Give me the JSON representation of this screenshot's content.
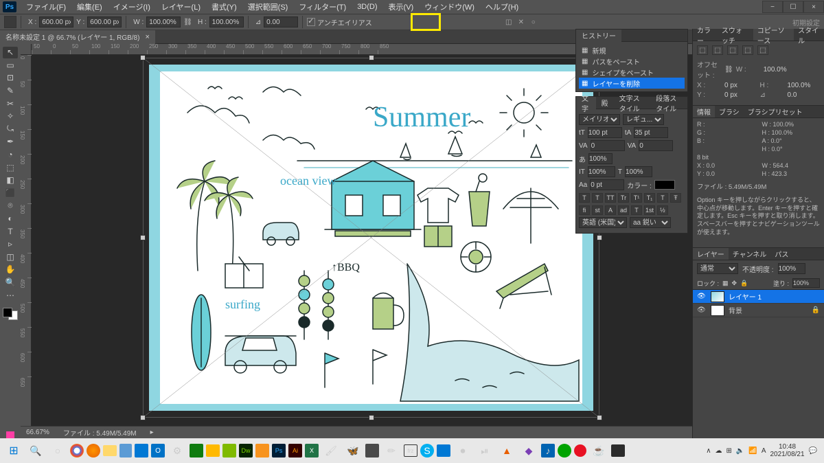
{
  "app": {
    "logo": "Ps"
  },
  "menu": {
    "items": [
      "ファイル(F)",
      "編集(E)",
      "イメージ(I)",
      "レイヤー(L)",
      "書式(Y)",
      "選択範囲(S)",
      "フィルター(T)",
      "3D(D)",
      "表示(V)",
      "ウィンドウ(W)",
      "ヘルプ(H)"
    ]
  },
  "winctrl": {
    "min": "−",
    "max": "☐",
    "close": "×"
  },
  "options": {
    "x_label": "X :",
    "x_val": "600.00 px",
    "y_label": "Y :",
    "y_val": "600.00 px",
    "w_label": "W :",
    "w_val": "100.00%",
    "h_label": "H :",
    "h_val": "100.00%",
    "angle_label": "⊿",
    "angle_val": "0.00",
    "antialias_label": "アンチエイリアス",
    "cancel_glyph": "✕",
    "commit_glyph": "○",
    "workspace": "初期設定"
  },
  "doctab": {
    "title": "名称未設定 1 @ 66.7% (レイヤー 1, RGB/8)",
    "close": "×"
  },
  "ruler_h": [
    "50",
    "0",
    "50",
    "100",
    "150",
    "200",
    "250",
    "300",
    "350",
    "400",
    "450",
    "500",
    "550",
    "600",
    "650",
    "700",
    "750",
    "800",
    "850"
  ],
  "ruler_v": [
    "0",
    "50",
    "100",
    "150",
    "200",
    "250",
    "300",
    "350",
    "400",
    "450",
    "500",
    "550",
    "600",
    "650"
  ],
  "tools": [
    "↖",
    "▭",
    "⊡",
    "✎",
    "✂",
    "✧",
    "⤿",
    "✒",
    "◔",
    "⬚",
    "◧",
    "⬛",
    "⌾",
    "◐",
    "T",
    "▹",
    "◫",
    "✋",
    "🔍",
    "⋯"
  ],
  "history": {
    "tab": "ヒストリー",
    "items": [
      "新規",
      "パスをペースト",
      "シェイプをペースト",
      "レイヤーを削除"
    ]
  },
  "char": {
    "tabs": [
      "文字",
      "殿",
      "文字スタイル",
      "段落スタイル"
    ],
    "font": "メイリオ",
    "style": "レギュ...",
    "size": "100 pt",
    "lead": "35 pt",
    "va": "VA",
    "va_val": "0",
    "tracking": "0",
    "scale_h": "100%",
    "scale_v": "100%",
    "baseline": "0 pt",
    "color_label": "カラー :",
    "styles": [
      "T",
      "T",
      "TT",
      "Tr",
      "T¹",
      "T₁",
      "T",
      "Ŧ"
    ],
    "lang": "英語 (米国)",
    "aa": "aa 鋭い"
  },
  "copysource": {
    "tabs": [
      "カラー",
      "スウォッチ",
      "コピーソース",
      "スタイル"
    ],
    "offset_label": "オフセット :",
    "x_label": "X :",
    "x_val": "0 px",
    "y_label": "Y :",
    "y_val": "0 px",
    "w_label": "W :",
    "w_val": "100.0%",
    "h_label": "H :",
    "h_val": "100.0%",
    "angle": "⊿",
    "angle_val": "0.0"
  },
  "info": {
    "tabs": [
      "情報",
      "ブラシ",
      "ブラシプリセット"
    ],
    "r": "R :",
    "g": "G :",
    "b": "B :",
    "w": "W :",
    "w_val": "100.0%",
    "h": "H :",
    "h_val": "100.0%",
    "a": "A :",
    "a_val": "0.0°",
    "hh": "H :",
    "hh_val": "0.0°",
    "bit": "8 bit",
    "x": "X :",
    "x_val": "0.0",
    "y": "Y :",
    "y_val": "0.0",
    "ww": "W :",
    "ww_val": "564.4",
    "hhh": "H :",
    "hhh_val": "423.3",
    "file": "ファイル : 5.49M/5.49M",
    "hint": "Option キーを押しながらクリックすると、中心点が移動します。Enter キーを押すと確定します。Esc キーを押すと取り消します。スペースバーを押すとナビゲーションツールが使えます。"
  },
  "layers": {
    "tabs": [
      "レイヤー",
      "チャンネル",
      "パス"
    ],
    "blend": "通常",
    "opacity_label": "不透明度 :",
    "opacity": "100%",
    "lock_label": "ロック :",
    "fill_label": "塗り :",
    "fill": "100%",
    "items": [
      "レイヤー 1",
      "背景"
    ]
  },
  "status": {
    "zoom": "66.67%",
    "file": "ファイル : 5.49M/5.49M"
  },
  "taskbar": {
    "start": "⊞",
    "icons": [
      "🔍",
      "○",
      "🌐",
      "🦊",
      "📁",
      "📄",
      "🖼",
      "📧",
      "⚙",
      "📊",
      "📁",
      "🟩",
      "⬛",
      "🟧",
      "🟦",
      "🟨",
      "📗",
      "🖌",
      "🦋",
      "🗂",
      "🎬",
      "⌨",
      "🔵",
      "🎥",
      "⏺",
      "⏯",
      "▲",
      "🔷",
      "🎵",
      "🌐",
      "🔴",
      "☕",
      "⬛"
    ],
    "tray": [
      "∧",
      "☁",
      "🔈",
      "🌐",
      "🔋",
      "A"
    ],
    "time": "10:48",
    "date": "2021/08/21"
  },
  "illus": {
    "title": "Summer",
    "ocean": "ocean view",
    "bbq": "↑BBQ",
    "surf": "surfing"
  }
}
